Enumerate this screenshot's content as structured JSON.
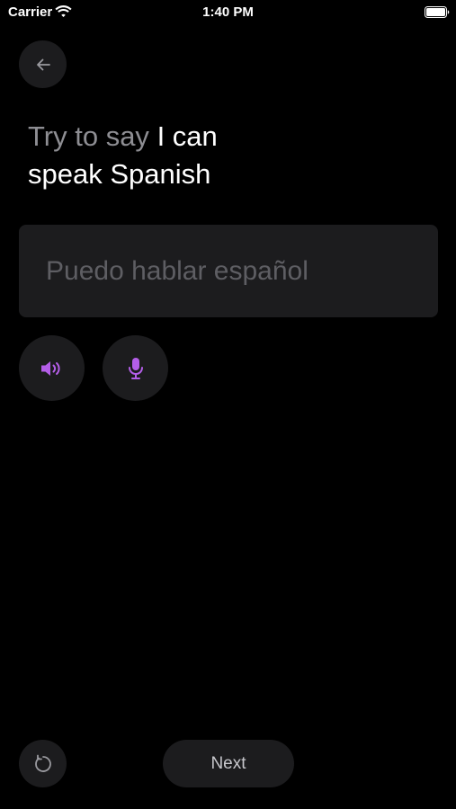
{
  "status_bar": {
    "carrier": "Carrier",
    "time": "1:40 PM",
    "icons": [
      "wifi-icon",
      "battery-icon"
    ]
  },
  "nav": {
    "back_icon": "arrow-left-icon"
  },
  "prompt": {
    "lead": "Try to say",
    "phrase": "I can speak Spanish"
  },
  "answer": {
    "placeholder": "Puedo hablar español"
  },
  "actions": {
    "speaker_icon": "speaker-icon",
    "mic_icon": "microphone-icon"
  },
  "footer": {
    "restart_icon": "restart-icon",
    "next_label": "Next"
  },
  "colors": {
    "background": "#000000",
    "surface": "#1c1c1e",
    "accent": "#b45ee8",
    "muted_text": "#8e8e93",
    "placeholder_text": "#5e5e63"
  }
}
